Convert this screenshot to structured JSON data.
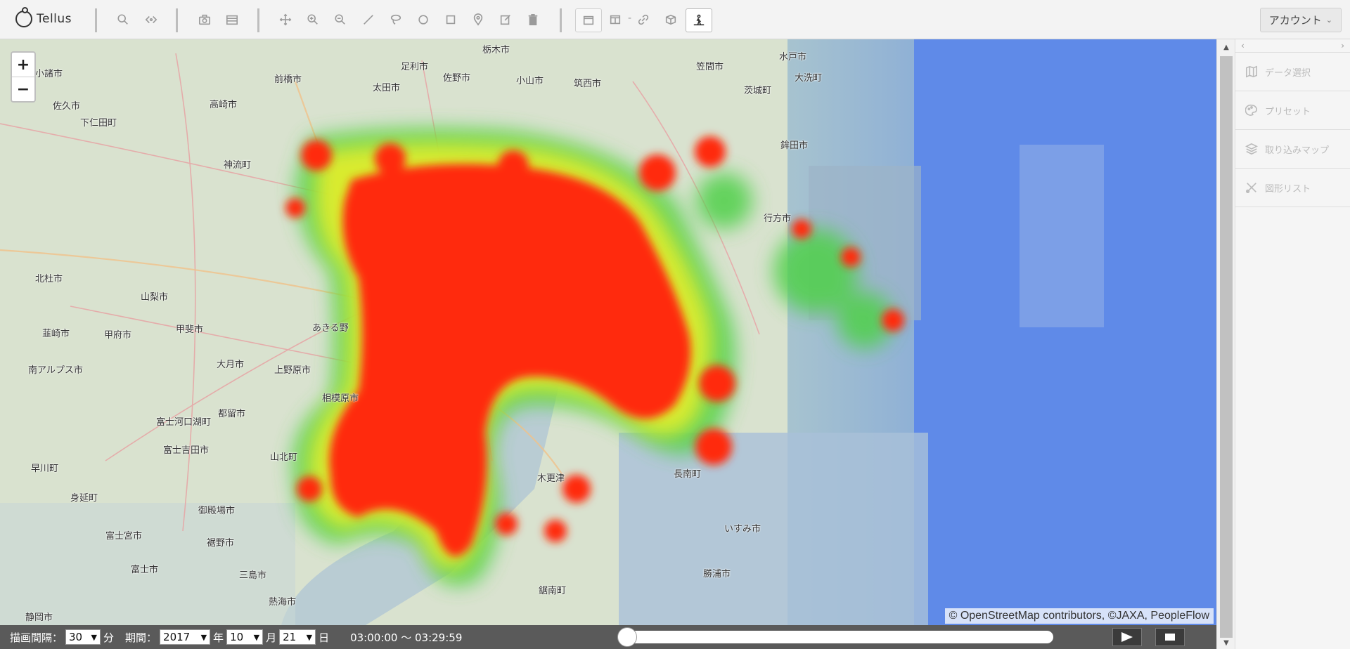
{
  "app": {
    "logo_text": "Tellus"
  },
  "toolbar": {
    "account_label": "アカウント",
    "tools": [
      "search-icon",
      "compare-icon",
      "camera-icon",
      "calendar-icon",
      "move-icon",
      "zoom-in-icon",
      "zoom-out-icon",
      "line-icon",
      "lasso-icon",
      "circle-icon",
      "square-icon",
      "pin-icon",
      "edit-icon",
      "trash-icon",
      "window-icon",
      "split-icon",
      "link-icon",
      "cube-icon",
      "person-walk-icon"
    ]
  },
  "map": {
    "zoom_in": "+",
    "zoom_out": "−",
    "attribution": "© OpenStreetMap contributors, ©JAXA, PeopleFlow",
    "places": {
      "p1": "小諸市",
      "p2": "佐久市",
      "p3": "高崎市",
      "p4": "前橋市",
      "p5": "太田市",
      "p6": "佐野市",
      "p7": "足利市",
      "p8": "栃木市",
      "p9": "小山市",
      "p10": "筑西市",
      "p11": "笠間市",
      "p12": "水戸市",
      "p13": "茨城町",
      "p14": "大洗町",
      "p15": "下仁田町",
      "p16": "神流町",
      "p17": "鉾田市",
      "p18": "行方市",
      "p19": "北杜市",
      "p20": "山梨市",
      "p21": "韮崎市",
      "p22": "甲府市",
      "p23": "甲斐市",
      "p24": "南アルプス市",
      "p25": "大月市",
      "p26": "上野原市",
      "p27": "都留市",
      "p28": "相模原市",
      "p29": "富士河口湖町",
      "p30": "富士吉田市",
      "p31": "山北町",
      "p32": "御殿場市",
      "p33": "裾野市",
      "p34": "富士宮市",
      "p35": "富士市",
      "p36": "静岡市",
      "p37": "熱海市",
      "p38": "三島市",
      "p39": "いすみ市",
      "p40": "長南町",
      "p41": "木更津",
      "p42": "鋸南町",
      "p43": "勝浦市",
      "p44": "あきる野",
      "p45": "早川町",
      "p46": "身延町"
    }
  },
  "sidepanel": {
    "items": [
      {
        "icon": "map-icon",
        "label": "データ選択"
      },
      {
        "icon": "palette-icon",
        "label": "プリセット"
      },
      {
        "icon": "layers-icon",
        "label": "取り込みマップ"
      },
      {
        "icon": "tools-icon",
        "label": "図形リスト"
      }
    ]
  },
  "playback": {
    "interval_label": "描画間隔：",
    "interval_value": "30",
    "interval_unit": "分",
    "period_label": "期間：",
    "year_value": "2017",
    "year_unit": "年",
    "month_value": "10",
    "month_unit": "月",
    "day_value": "21",
    "day_unit": "日",
    "time_range": "03:00:00 〜 03:29:59",
    "progress": 0
  }
}
